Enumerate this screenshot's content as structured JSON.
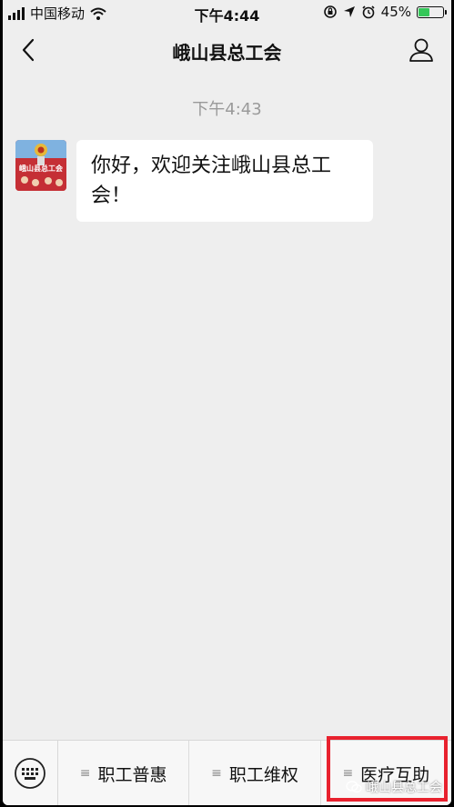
{
  "status_bar": {
    "carrier": "中国移动",
    "time": "下午4:44",
    "battery": "45%",
    "battery_level": 0.45
  },
  "nav": {
    "title": "峨山县总工会"
  },
  "chat": {
    "timestamp": "下午4:43",
    "message": "你好，欢迎关注峨山县总工会！",
    "avatar_text": "峨山县总工会"
  },
  "menu": {
    "items": [
      {
        "label": "职工普惠"
      },
      {
        "label": "职工维权"
      },
      {
        "label": "医疗互助"
      }
    ]
  },
  "watermark": "峨山县总工会"
}
